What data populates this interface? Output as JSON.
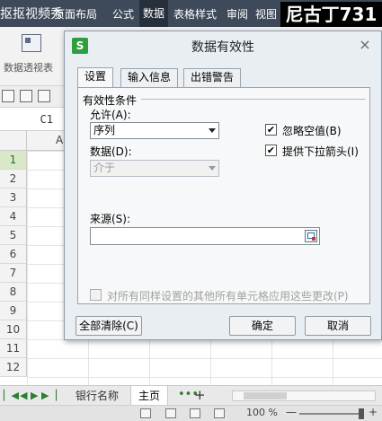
{
  "app": {
    "title": "抠抠视频秀",
    "menus": [
      "页面布局",
      "公式",
      "数据",
      "表格样式",
      "审阅",
      "视图"
    ],
    "active_menu": "数据",
    "watermark": "尼古丁731"
  },
  "ribbon": {
    "pivot_label": "数据透视表"
  },
  "formula_bar": {
    "cell_ref": "C1"
  },
  "sheet": {
    "column_header": "A",
    "rows": [
      "1",
      "2",
      "3",
      "4",
      "5",
      "6",
      "7",
      "8",
      "9",
      "10",
      "11",
      "12"
    ],
    "selected_row": "1",
    "tabs": [
      "银行名称",
      "主页"
    ],
    "active_tab": "主页",
    "more_tabs": "•••",
    "add_tab": "+"
  },
  "status": {
    "zoom": "100 %",
    "zoom_minus": "—",
    "zoom_plus": "+"
  },
  "dialog": {
    "logo": "S",
    "title": "数据有效性",
    "close": "×",
    "tabs": [
      "设置",
      "输入信息",
      "出错警告"
    ],
    "active_tab": "设置",
    "group_title": "有效性条件",
    "allow_label": "允许(A):",
    "allow_value": "序列",
    "data_label": "数据(D):",
    "data_value": "介于",
    "ignore_blank_label": "忽略空值(B)",
    "ignore_blank_checked": "✔",
    "dropdown_label": "提供下拉箭头(I)",
    "dropdown_checked": "✔",
    "source_label": "来源(S):",
    "source_value": "",
    "apply_all_label": "对所有同样设置的其他所有单元格应用这些更改(P)",
    "clear_all_button": "全部清除(C)",
    "ok_button": "确定",
    "cancel_button": "取消"
  }
}
